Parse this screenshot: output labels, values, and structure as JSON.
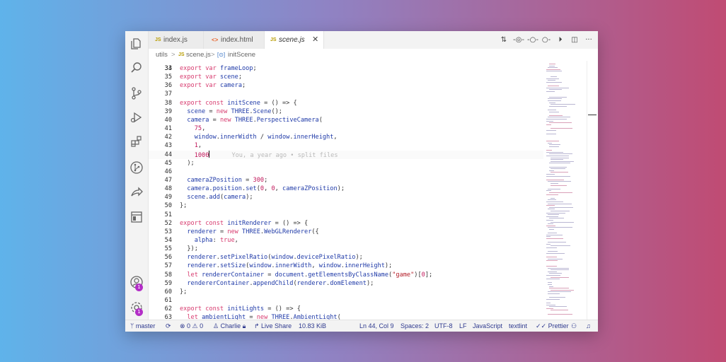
{
  "tabs": [
    {
      "icon": "JS",
      "label": "index.js"
    },
    {
      "icon": "<>",
      "label": "index.html"
    },
    {
      "icon": "JS",
      "label": "scene.js",
      "close": "✕"
    }
  ],
  "breadcrumb": {
    "folder": "utils",
    "sep1": ">",
    "file_icon": "JS",
    "file": "scene.js",
    "sep2": ">",
    "symbol_icon": "[⊙]",
    "symbol": "initScene"
  },
  "toolbar": {
    "more": "···"
  },
  "editor": {
    "blame": "You, a year ago • split files",
    "top_partial_line": "33"
  },
  "code_lines": [
    {
      "n": "34",
      "t": "export var frameLoop;"
    },
    {
      "n": "35",
      "t": "export var scene;"
    },
    {
      "n": "36",
      "t": "export var camera;"
    },
    {
      "n": "37",
      "t": ""
    },
    {
      "n": "38",
      "t": "export const initScene = () => {"
    },
    {
      "n": "39",
      "t": "  scene = new THREE.Scene();"
    },
    {
      "n": "40",
      "t": "  camera = new THREE.PerspectiveCamera("
    },
    {
      "n": "41",
      "t": "    75,"
    },
    {
      "n": "42",
      "t": "    window.innerWidth / window.innerHeight,"
    },
    {
      "n": "43",
      "t": "    1,"
    },
    {
      "n": "44",
      "t": "    1000"
    },
    {
      "n": "45",
      "t": "  );"
    },
    {
      "n": "46",
      "t": ""
    },
    {
      "n": "47",
      "t": "  cameraZPosition = 300;"
    },
    {
      "n": "48",
      "t": "  camera.position.set(0, 0, cameraZPosition);"
    },
    {
      "n": "49",
      "t": "  scene.add(camera);"
    },
    {
      "n": "50",
      "t": "};"
    },
    {
      "n": "51",
      "t": ""
    },
    {
      "n": "52",
      "t": "export const initRenderer = () => {"
    },
    {
      "n": "53",
      "t": "  renderer = new THREE.WebGLRenderer({"
    },
    {
      "n": "54",
      "t": "    alpha: true,"
    },
    {
      "n": "55",
      "t": "  });"
    },
    {
      "n": "56",
      "t": "  renderer.setPixelRatio(window.devicePixelRatio);"
    },
    {
      "n": "57",
      "t": "  renderer.setSize(window.innerWidth, window.innerHeight);"
    },
    {
      "n": "58",
      "t": "  let rendererContainer = document.getElementsByClassName(\"game\")[0];"
    },
    {
      "n": "59",
      "t": "  rendererContainer.appendChild(renderer.domElement);"
    },
    {
      "n": "60",
      "t": "};"
    },
    {
      "n": "61",
      "t": ""
    },
    {
      "n": "62",
      "t": "export const initLights = () => {"
    },
    {
      "n": "63",
      "t": "  let ambientLight = new THREE.AmbientLight("
    }
  ],
  "cursor_line": "44",
  "activity_badges": {
    "accounts": "1",
    "manage": "1"
  },
  "status": {
    "branch": "master",
    "problems": "⊗ 0 ⚠ 0",
    "liveshare_user": "Charlie",
    "live_share": "Live Share",
    "file_size": "10.83 KiB",
    "position": "Ln 44, Col 9",
    "spaces": "Spaces: 2",
    "encoding": "UTF-8",
    "eol": "LF",
    "language": "JavaScript",
    "lint": "textlint",
    "prettier": "Prettier"
  },
  "colors": {
    "keyword": "#d73a6e",
    "variable": "#1f3aa8",
    "number": "#c2185b",
    "string": "#b31d28",
    "status_text": "#2f3a8f",
    "badge": "#b32ec7"
  }
}
